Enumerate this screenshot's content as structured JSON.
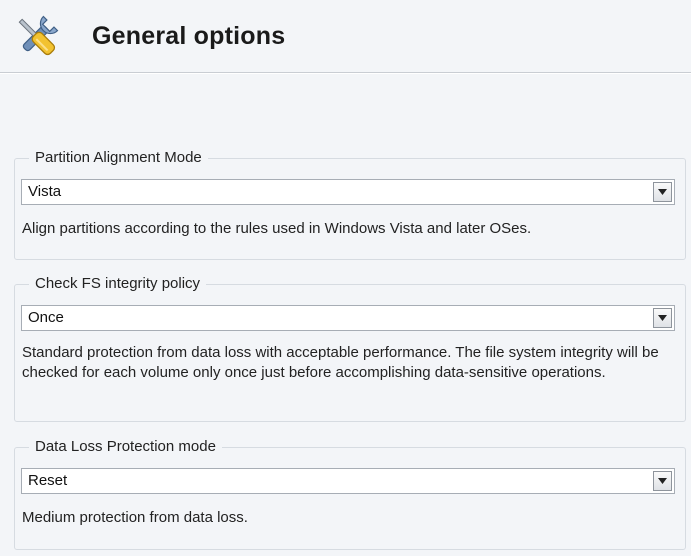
{
  "header": {
    "title": "General options",
    "icon": "tools-icon"
  },
  "groups": [
    {
      "legend": "Partition Alignment Mode",
      "selected": "Vista",
      "description": "Align partitions according to the rules used in Windows Vista and later OSes."
    },
    {
      "legend": "Check FS integrity policy",
      "selected": "Once",
      "description": "Standard protection from data loss with acceptable performance. The file system integrity will be checked for each volume only once just before accomplishing data-sensitive operations."
    },
    {
      "legend": "Data Loss Protection mode",
      "selected": "Reset",
      "description": "Medium protection from data loss."
    }
  ],
  "colors": {
    "background": "#f3f5f8",
    "combo_border": "#a7adb5",
    "group_border": "#d6dbe1"
  }
}
